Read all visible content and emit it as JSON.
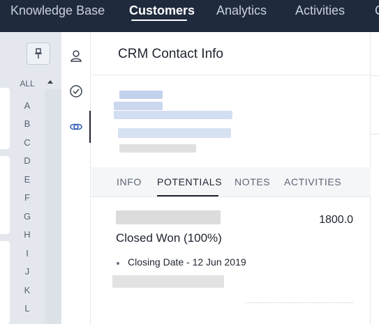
{
  "nav": {
    "items": [
      {
        "label": "Knowledge Base",
        "active": false
      },
      {
        "label": "Customers",
        "active": true
      },
      {
        "label": "Analytics",
        "active": false
      },
      {
        "label": "Activities",
        "active": false
      },
      {
        "label": "C",
        "active": false
      }
    ]
  },
  "alphabet": {
    "all_label": "ALL",
    "letters": [
      "A",
      "B",
      "C",
      "D",
      "E",
      "F",
      "G",
      "H",
      "I",
      "J",
      "K",
      "L"
    ]
  },
  "rail": {
    "icons": [
      "contact-icon",
      "check-circle-icon",
      "link-icon"
    ],
    "active": "link-icon"
  },
  "panel": {
    "title": "CRM Contact Info",
    "tabs": [
      {
        "label": "INFO",
        "active": false
      },
      {
        "label": "POTENTIALS",
        "active": true
      },
      {
        "label": "NOTES",
        "active": false
      },
      {
        "label": "ACTIVITIES",
        "active": false
      }
    ],
    "potential": {
      "amount": "1800.0",
      "stage": "Closed Won (100%)",
      "closing_date": "Closing Date - 12 Jun 2019"
    }
  },
  "colors": {
    "nav_bg": "#1f2a3c",
    "left_panel_bg": "#e4e8ee",
    "accent_link": "#3d66b8"
  }
}
